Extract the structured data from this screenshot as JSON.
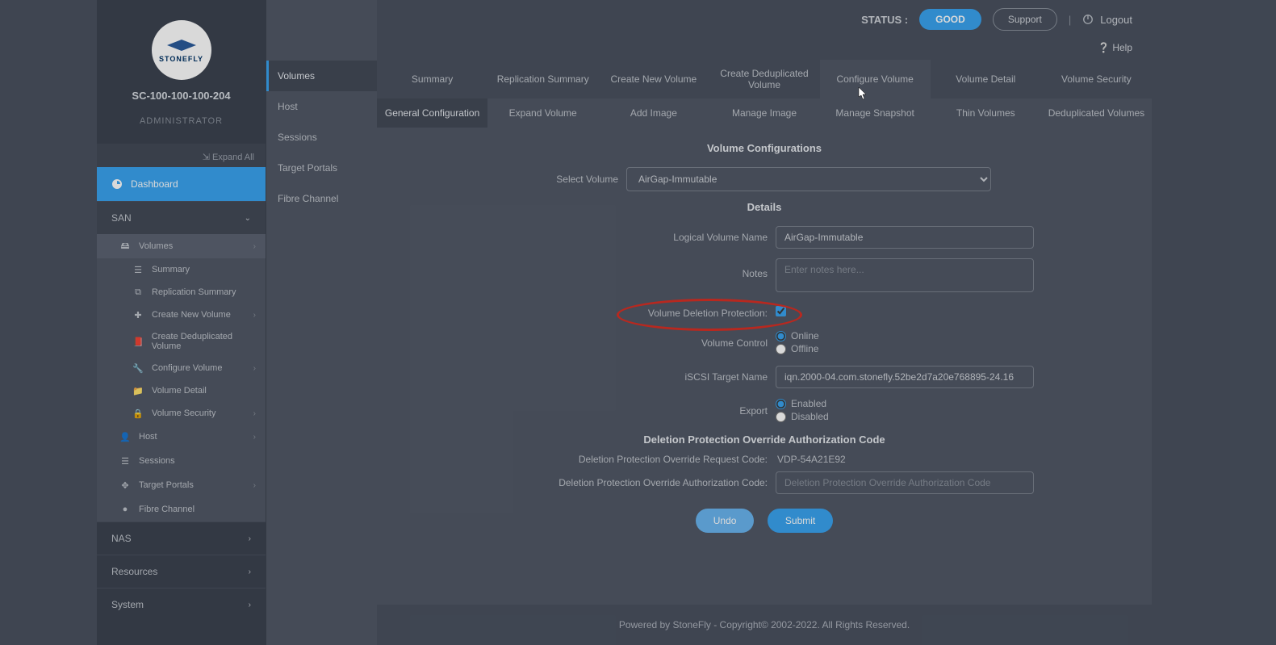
{
  "brand": {
    "name": "STONEFLY"
  },
  "header": {
    "system_name": "SC-100-100-100-204",
    "role": "ADMINISTRATOR",
    "expand_all": "Expand All"
  },
  "topbar": {
    "status_label": "STATUS :",
    "status_value": "GOOD",
    "support": "Support",
    "logout": "Logout",
    "help": "Help"
  },
  "primary_nav": {
    "dashboard": "Dashboard",
    "san": "SAN",
    "nas": "NAS",
    "resources": "Resources",
    "system": "System"
  },
  "san_tree": {
    "volumes": "Volumes",
    "summary": "Summary",
    "replication_summary": "Replication Summary",
    "create_new_volume": "Create New Volume",
    "create_dedup_volume": "Create Deduplicated Volume",
    "configure_volume": "Configure Volume",
    "volume_detail": "Volume Detail",
    "volume_security": "Volume Security",
    "host": "Host",
    "sessions": "Sessions",
    "target_portals": "Target Portals",
    "fibre_channel": "Fibre Channel"
  },
  "sec_nav": {
    "volumes": "Volumes",
    "host": "Host",
    "sessions": "Sessions",
    "target_portals": "Target Portals",
    "fibre_channel": "Fibre Channel"
  },
  "tabs": {
    "summary": "Summary",
    "replication_summary": "Replication Summary",
    "create_new_volume": "Create New Volume",
    "create_dedup_volume": "Create Deduplicated Volume",
    "configure_volume": "Configure Volume",
    "volume_detail": "Volume Detail",
    "volume_security": "Volume Security"
  },
  "subtabs": {
    "general_configuration": "General Configuration",
    "expand_volume": "Expand Volume",
    "add_image": "Add Image",
    "manage_image": "Manage Image",
    "manage_snapshot": "Manage Snapshot",
    "thin_volumes": "Thin Volumes",
    "deduplicated_volumes": "Deduplicated Volumes"
  },
  "form": {
    "title_config": "Volume Configurations",
    "select_volume_label": "Select Volume",
    "select_volume_value": "AirGap-Immutable",
    "title_details": "Details",
    "logical_name_label": "Logical Volume Name",
    "logical_name_value": "AirGap-Immutable",
    "notes_label": "Notes",
    "notes_placeholder": "Enter notes here...",
    "deletion_protection_label": "Volume Deletion Protection:",
    "volume_control_label": "Volume Control",
    "online": "Online",
    "offline": "Offline",
    "iscsi_label": "iSCSI Target Name",
    "iscsi_value": "iqn.2000-04.com.stonefly.52be2d7a20e768895-24.16",
    "export_label": "Export",
    "enabled": "Enabled",
    "disabled": "Disabled",
    "override_title": "Deletion Protection Override Authorization Code",
    "request_code_label": "Deletion Protection Override Request Code:",
    "request_code_value": "VDP-54A21E92",
    "auth_code_label": "Deletion Protection Override Authorization Code:",
    "auth_code_placeholder": "Deletion Protection Override Authorization Code",
    "undo": "Undo",
    "submit": "Submit"
  },
  "footer": {
    "text": "Powered by StoneFly - Copyright© 2002-2022. All Rights Reserved."
  }
}
